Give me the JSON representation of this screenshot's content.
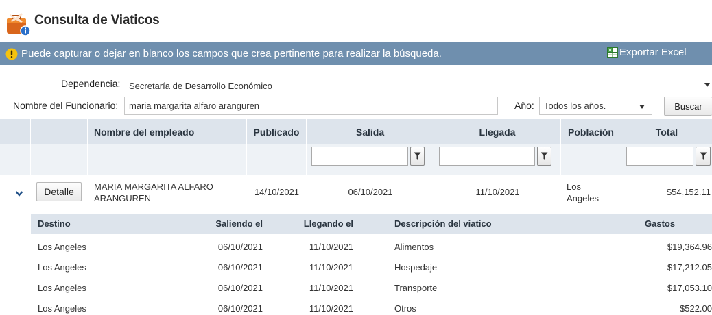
{
  "page": {
    "title": "Consulta de Viaticos"
  },
  "info": {
    "message": "Puede capturar o dejar en blanco los campos que crea pertinente para realizar la búsqueda.",
    "export_label": "Exportar Excel"
  },
  "form": {
    "dependencia_label": "Dependencia:",
    "dependencia_value": "Secretaría de Desarrollo Económico",
    "nombre_label": "Nombre del Funcionario:",
    "nombre_value": "maria margarita alfaro aranguren",
    "anio_label": "Año:",
    "anio_value": "Todos los años.",
    "buscar_label": "Buscar"
  },
  "grid": {
    "columns": [
      "Nombre del empleado",
      "Publicado",
      "Salida",
      "Llegada",
      "Población",
      "Total"
    ],
    "row": {
      "detalle_label": "Detalle",
      "empleado_line1": "MARIA MARGARITA ALFARO",
      "empleado_line2": "ARANGUREN",
      "publicado": "14/10/2021",
      "salida": "06/10/2021",
      "llegada": "11/10/2021",
      "poblacion_line1": "Los",
      "poblacion_line2": "Angeles",
      "total": "$54,152.11"
    }
  },
  "detail": {
    "columns": [
      "Destino",
      "Saliendo el",
      "Llegando el",
      "Descripción del viatico",
      "Gastos"
    ],
    "rows": [
      [
        "Los Angeles",
        "06/10/2021",
        "11/10/2021",
        "Alimentos",
        "$19,364.96"
      ],
      [
        "Los Angeles",
        "06/10/2021",
        "11/10/2021",
        "Hospedaje",
        "$17,212.05"
      ],
      [
        "Los Angeles",
        "06/10/2021",
        "11/10/2021",
        "Transporte",
        "$17,053.10"
      ],
      [
        "Los Angeles",
        "06/10/2021",
        "11/10/2021",
        "Otros",
        "$522.00"
      ]
    ]
  },
  "colors": {
    "infobar": "#6f8fae",
    "header": "#dde4ec",
    "filter_row": "#eef2f6",
    "expand_chevron": "#1f4f87"
  }
}
